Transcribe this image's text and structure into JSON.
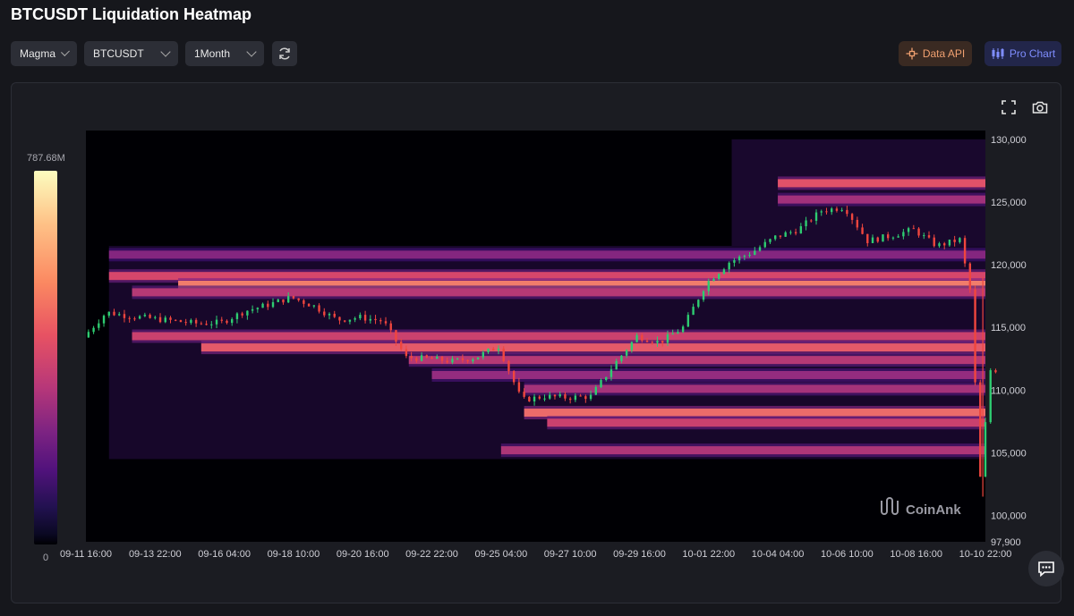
{
  "header": {
    "title": "BTCUSDT Liquidation Heatmap"
  },
  "controls": {
    "color_scheme": "Magma",
    "symbol": "BTCUSDT",
    "period": "1Month",
    "data_api_label": "Data API",
    "pro_chart_label": "Pro Chart"
  },
  "icons": {
    "refresh": "refresh-icon",
    "fullscreen": "fullscreen-icon",
    "screenshot": "camera-icon",
    "chat": "chat-icon",
    "data_api": "data-api-icon",
    "pro_chart": "candles-icon"
  },
  "colors": {
    "up": "#2ecc71",
    "down": "#f0463e",
    "api_accent": "#f0a070",
    "pro_accent": "#7f8dff"
  },
  "watermark": "CoinAnk",
  "chart_data": {
    "type": "heatmap",
    "title": "BTCUSDT Liquidation Heatmap",
    "color_scale": {
      "name": "Magma",
      "min_label": "0",
      "max_label": "787.68M"
    },
    "y_axis": {
      "ticks": [
        130000,
        125000,
        120000,
        115000,
        110000,
        105000,
        100000
      ],
      "tick_labels": [
        "130,000",
        "125,000",
        "120,000",
        "115,000",
        "110,000",
        "105,000",
        "100,000"
      ],
      "bottom_label": "97,900",
      "ylim": [
        97900,
        130700
      ]
    },
    "x_axis": {
      "tick_labels": [
        "09-11 16:00",
        "09-13 22:00",
        "09-16 04:00",
        "09-18 10:00",
        "09-20 16:00",
        "09-22 22:00",
        "09-25 04:00",
        "09-27 10:00",
        "09-29 16:00",
        "10-01 22:00",
        "10-04 04:00",
        "10-06 10:00",
        "10-08 16:00",
        "10-10 22:00"
      ]
    },
    "price_path": [
      [
        "09-11 16:00",
        114200
      ],
      [
        "09-12 10:00",
        116200
      ],
      [
        "09-13 04:00",
        115900
      ],
      [
        "09-13 22:00",
        115700
      ],
      [
        "09-14 16:00",
        115500
      ],
      [
        "09-15 10:00",
        115300
      ],
      [
        "09-16 04:00",
        115400
      ],
      [
        "09-16 22:00",
        116300
      ],
      [
        "09-17 16:00",
        116800
      ],
      [
        "09-18 10:00",
        117400
      ],
      [
        "09-19 04:00",
        116700
      ],
      [
        "09-19 22:00",
        115600
      ],
      [
        "09-20 16:00",
        115800
      ],
      [
        "09-21 10:00",
        115500
      ],
      [
        "09-22 04:00",
        112600
      ],
      [
        "09-22 22:00",
        112500
      ],
      [
        "09-23 16:00",
        112300
      ],
      [
        "09-24 10:00",
        112600
      ],
      [
        "09-25 04:00",
        113500
      ],
      [
        "09-25 22:00",
        109200
      ],
      [
        "09-26 16:00",
        109500
      ],
      [
        "09-27 10:00",
        109400
      ],
      [
        "09-28 04:00",
        109500
      ],
      [
        "09-28 22:00",
        112000
      ],
      [
        "09-29 16:00",
        114300
      ],
      [
        "09-30 10:00",
        113800
      ],
      [
        "10-01 04:00",
        115000
      ],
      [
        "10-01 22:00",
        118500
      ],
      [
        "10-02 16:00",
        120200
      ],
      [
        "10-03 10:00",
        121000
      ],
      [
        "10-04 04:00",
        122200
      ],
      [
        "10-04 22:00",
        122800
      ],
      [
        "10-05 16:00",
        124300
      ],
      [
        "10-06 10:00",
        124600
      ],
      [
        "10-07 04:00",
        121900
      ],
      [
        "10-07 22:00",
        122300
      ],
      [
        "10-08 16:00",
        122800
      ],
      [
        "10-09 10:00",
        121500
      ],
      [
        "10-10 04:00",
        122000
      ],
      [
        "10-10 12:00",
        118000
      ],
      [
        "10-10 20:00",
        103000
      ],
      [
        "10-11 04:00",
        111600
      ]
    ],
    "liquidation_bands": [
      {
        "price": 126500,
        "intensity": 0.62,
        "from": "10-04 04:00"
      },
      {
        "price": 125200,
        "intensity": 0.45,
        "from": "10-04 04:00"
      },
      {
        "price": 120800,
        "intensity": 0.38,
        "from": "09-12 10:00"
      },
      {
        "price": 119100,
        "intensity": 0.58,
        "from": "09-12 10:00"
      },
      {
        "price": 118400,
        "intensity": 0.72,
        "from": "09-14 16:00"
      },
      {
        "price": 117800,
        "intensity": 0.5,
        "from": "09-13 04:00"
      },
      {
        "price": 114300,
        "intensity": 0.55,
        "from": "09-13 04:00"
      },
      {
        "price": 113400,
        "intensity": 0.64,
        "from": "09-15 10:00"
      },
      {
        "price": 112400,
        "intensity": 0.5,
        "from": "09-22 04:00"
      },
      {
        "price": 111200,
        "intensity": 0.42,
        "from": "09-22 22:00"
      },
      {
        "price": 110100,
        "intensity": 0.46,
        "from": "09-25 22:00"
      },
      {
        "price": 108200,
        "intensity": 0.68,
        "from": "09-25 22:00"
      },
      {
        "price": 107400,
        "intensity": 0.55,
        "from": "09-26 16:00"
      },
      {
        "price": 105200,
        "intensity": 0.48,
        "from": "09-25 04:00"
      }
    ]
  }
}
